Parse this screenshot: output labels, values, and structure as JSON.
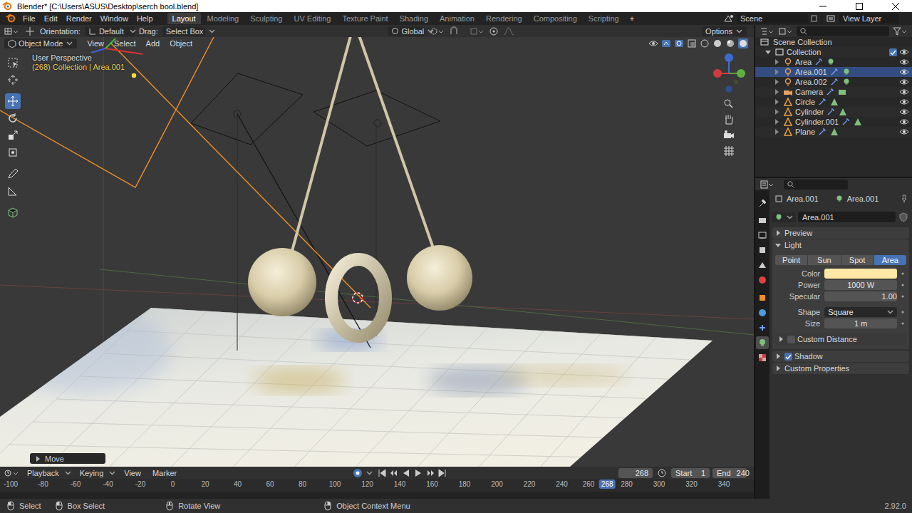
{
  "window": {
    "title": "Blender* [C:\\Users\\ASUS\\Desktop\\serch bool.blend]"
  },
  "menu": [
    "File",
    "Edit",
    "Render",
    "Window",
    "Help"
  ],
  "workspaces": [
    {
      "label": "Layout",
      "selected": true
    },
    {
      "label": "Modeling",
      "selected": false
    },
    {
      "label": "Sculpting",
      "selected": false
    },
    {
      "label": "UV Editing",
      "selected": false
    },
    {
      "label": "Texture Paint",
      "selected": false
    },
    {
      "label": "Shading",
      "selected": false
    },
    {
      "label": "Animation",
      "selected": false
    },
    {
      "label": "Rendering",
      "selected": false
    },
    {
      "label": "Compositing",
      "selected": false
    },
    {
      "label": "Scripting",
      "selected": false
    }
  ],
  "workspace_add": "+",
  "scene": {
    "scene": "Scene",
    "view_layer": "View Layer"
  },
  "viewport_header": {
    "orientation_label": "Orientation:",
    "orientation": "Default",
    "drag_label": "Drag:",
    "drag": "Select Box",
    "transform": "Global",
    "options": "Options"
  },
  "viewport_menu": {
    "mode": "Object Mode",
    "items": [
      "View",
      "Select",
      "Add",
      "Object"
    ]
  },
  "tools": [
    {
      "kind": "select",
      "selected": false
    },
    {
      "kind": "cursor",
      "selected": false
    },
    {
      "kind": "move",
      "selected": true
    },
    {
      "kind": "rotate",
      "selected": false
    },
    {
      "kind": "scale",
      "selected": false
    },
    {
      "kind": "transform",
      "selected": false
    },
    {
      "kind": "annotate",
      "selected": false
    },
    {
      "kind": "measure",
      "selected": false
    },
    {
      "kind": "add",
      "selected": false
    }
  ],
  "viewport_overlay": {
    "view": "User Perspective",
    "context": "(268) Collection | Area.001"
  },
  "operator_panel": {
    "label": "Move",
    "expanded": false
  },
  "outliner": {
    "root": "Scene Collection",
    "collection": "Collection",
    "collection_checked": true,
    "items": [
      {
        "name": "Area",
        "kind": "light",
        "selected": false,
        "visible": true
      },
      {
        "name": "Area.001",
        "kind": "light",
        "selected": true,
        "visible": true
      },
      {
        "name": "Area.002",
        "kind": "light",
        "selected": false,
        "visible": true
      },
      {
        "name": "Camera",
        "kind": "camera",
        "selected": false,
        "visible": true
      },
      {
        "name": "Circle",
        "kind": "mesh",
        "selected": false,
        "visible": true
      },
      {
        "name": "Cylinder",
        "kind": "mesh",
        "selected": false,
        "visible": true
      },
      {
        "name": "Cylinder.001",
        "kind": "mesh",
        "selected": false,
        "visible": true
      },
      {
        "name": "Plane",
        "kind": "mesh",
        "selected": false,
        "visible": true
      }
    ]
  },
  "properties": {
    "tabs": [
      {
        "kind": "tool",
        "selected": false
      },
      {
        "kind": "render",
        "selected": false
      },
      {
        "kind": "output",
        "selected": false
      },
      {
        "kind": "view-layer",
        "selected": false
      },
      {
        "kind": "scene",
        "selected": false
      },
      {
        "kind": "world",
        "selected": false
      },
      {
        "kind": "object",
        "selected": false
      },
      {
        "kind": "physics",
        "selected": false
      },
      {
        "kind": "constraints",
        "selected": false
      },
      {
        "kind": "light-data",
        "selected": true
      },
      {
        "kind": "texture",
        "selected": false
      }
    ],
    "breadcrumb": [
      "Area.001",
      "Area.001"
    ],
    "datablock": "Area.001",
    "preview": {
      "label": "Preview",
      "expanded": false
    },
    "light": {
      "label": "Light",
      "expanded": true,
      "types": [
        {
          "label": "Point",
          "selected": false
        },
        {
          "label": "Sun",
          "selected": false
        },
        {
          "label": "Spot",
          "selected": false
        },
        {
          "label": "Area",
          "selected": true
        }
      ],
      "fields": [
        {
          "kind": "color",
          "label": "Color",
          "color": "#ffe8a6"
        },
        {
          "kind": "number",
          "label": "Power",
          "value": "1000 W"
        },
        {
          "kind": "slider",
          "label": "Specular",
          "value": "1.00",
          "level": 1
        },
        {
          "kind": "dropdown",
          "label": "Shape",
          "value": "Square"
        },
        {
          "kind": "number",
          "label": "Size",
          "value": "1 m"
        }
      ],
      "subpanel": {
        "label": "Custom Distance",
        "expanded": false,
        "checked": false
      }
    },
    "shadow": {
      "label": "Shadow",
      "expanded": false,
      "checked": true
    },
    "custom": {
      "label": "Custom Properties",
      "expanded": false
    }
  },
  "timeline": {
    "menu": [
      "Playback",
      "Keying",
      "View",
      "Marker"
    ],
    "current_frame": "268",
    "start_label": "Start",
    "start": "1",
    "end_label": "End",
    "end": "240",
    "ruler": [
      "-100",
      "-80",
      "-60",
      "-40",
      "-20",
      "0",
      "20",
      "40",
      "60",
      "80",
      "100",
      "120",
      "140",
      "160",
      "180",
      "200",
      "220",
      "240",
      "260",
      "280",
      "300",
      "320",
      "340"
    ],
    "ruler_current": "268"
  },
  "status_bar": {
    "items": [
      "Select",
      "Box Select",
      "Rotate View",
      "Object Context Menu"
    ],
    "version": "2.92.0"
  }
}
